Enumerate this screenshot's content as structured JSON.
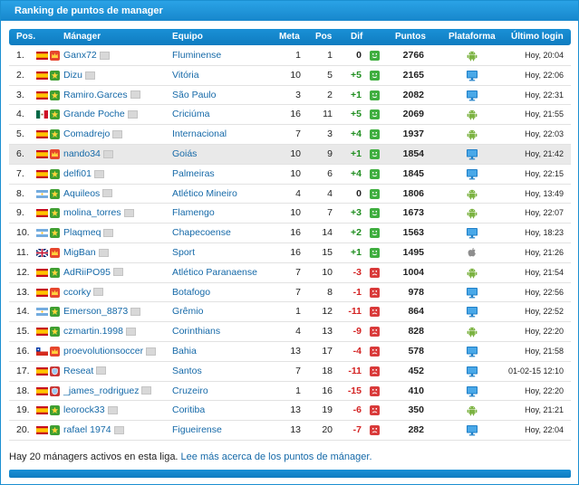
{
  "header": {
    "title": "Ranking de puntos de manager"
  },
  "columns": {
    "pos": "Pos.",
    "manager": "Mánager",
    "team": "Equipo",
    "meta": "Meta",
    "position": "Pos",
    "dif": "Dif",
    "points": "Puntos",
    "platform": "Plataforma",
    "last_login": "Último login"
  },
  "colors": {
    "accent": "#1787cc",
    "link": "#1569a8",
    "positive": "#1f8e1f",
    "negative": "#d42323",
    "face_green": "#3fae3f",
    "face_red": "#d93a3a"
  },
  "rows": [
    {
      "pos": "1.",
      "flag": "es",
      "badge": "crown",
      "name": "Ganx72",
      "team": "Fluminense",
      "meta": "1",
      "position": "1",
      "dif": "0",
      "face": "green",
      "points": "2766",
      "platform": "android",
      "login": "Hoy, 20:04"
    },
    {
      "pos": "2.",
      "flag": "es",
      "badge": "star",
      "name": "Dizu",
      "team": "Vitória",
      "meta": "10",
      "position": "5",
      "dif": "+5",
      "face": "green",
      "points": "2165",
      "platform": "pc",
      "login": "Hoy, 22:06"
    },
    {
      "pos": "3.",
      "flag": "es",
      "badge": "star",
      "name": "Ramiro.Garces",
      "team": "São Paulo",
      "meta": "3",
      "position": "2",
      "dif": "+1",
      "face": "green",
      "points": "2082",
      "platform": "pc",
      "login": "Hoy, 22:31"
    },
    {
      "pos": "4.",
      "flag": "mx",
      "badge": "star",
      "name": "Grande Poche",
      "team": "Criciúma",
      "meta": "16",
      "position": "11",
      "dif": "+5",
      "face": "green",
      "points": "2069",
      "platform": "android",
      "login": "Hoy, 21:55"
    },
    {
      "pos": "5.",
      "flag": "es",
      "badge": "star",
      "name": "Comadrejo",
      "team": "Internacional",
      "meta": "7",
      "position": "3",
      "dif": "+4",
      "face": "green",
      "points": "1937",
      "platform": "android",
      "login": "Hoy, 22:03"
    },
    {
      "pos": "6.",
      "flag": "es",
      "badge": "crown",
      "name": "nando34",
      "team": "Goiás",
      "meta": "10",
      "position": "9",
      "dif": "+1",
      "face": "green",
      "points": "1854",
      "platform": "pc",
      "login": "Hoy, 21:42",
      "highlight": true
    },
    {
      "pos": "7.",
      "flag": "es",
      "badge": "star",
      "name": "delfi01",
      "team": "Palmeiras",
      "meta": "10",
      "position": "6",
      "dif": "+4",
      "face": "green",
      "points": "1845",
      "platform": "pc",
      "login": "Hoy, 22:15"
    },
    {
      "pos": "8.",
      "flag": "ar",
      "badge": "star",
      "name": "Aquileos",
      "team": "Atlético Mineiro",
      "meta": "4",
      "position": "4",
      "dif": "0",
      "face": "green",
      "points": "1806",
      "platform": "android",
      "login": "Hoy, 13:49"
    },
    {
      "pos": "9.",
      "flag": "es",
      "badge": "star",
      "name": "molina_torres",
      "team": "Flamengo",
      "meta": "10",
      "position": "7",
      "dif": "+3",
      "face": "green",
      "points": "1673",
      "platform": "android",
      "login": "Hoy, 22:07"
    },
    {
      "pos": "10.",
      "flag": "ar",
      "badge": "star",
      "name": "Plaqmeq",
      "team": "Chapecoense",
      "meta": "16",
      "position": "14",
      "dif": "+2",
      "face": "green",
      "points": "1563",
      "platform": "pc",
      "login": "Hoy, 18:23"
    },
    {
      "pos": "11.",
      "flag": "gb",
      "badge": "crown",
      "name": "MigBan",
      "team": "Sport",
      "meta": "16",
      "position": "15",
      "dif": "+1",
      "face": "green",
      "points": "1495",
      "platform": "apple",
      "login": "Hoy, 21:26"
    },
    {
      "pos": "12.",
      "flag": "es",
      "badge": "star",
      "name": "AdRiiPO95",
      "team": "Atlético Paranaense",
      "meta": "7",
      "position": "10",
      "dif": "-3",
      "face": "red",
      "points": "1004",
      "platform": "android",
      "login": "Hoy, 21:54"
    },
    {
      "pos": "13.",
      "flag": "es",
      "badge": "crown",
      "name": "ccorky",
      "team": "Botafogo",
      "meta": "7",
      "position": "8",
      "dif": "-1",
      "face": "red",
      "points": "978",
      "platform": "pc",
      "login": "Hoy, 22:56"
    },
    {
      "pos": "14.",
      "flag": "ar",
      "badge": "star",
      "name": "Emerson_8873",
      "team": "Grêmio",
      "meta": "1",
      "position": "12",
      "dif": "-11",
      "face": "red",
      "points": "864",
      "platform": "pc",
      "login": "Hoy, 22:52"
    },
    {
      "pos": "15.",
      "flag": "es",
      "badge": "star",
      "name": "czmartin.1998",
      "team": "Corinthians",
      "meta": "4",
      "position": "13",
      "dif": "-9",
      "face": "red",
      "points": "828",
      "platform": "android",
      "login": "Hoy, 22:20"
    },
    {
      "pos": "16.",
      "flag": "cl",
      "badge": "crown",
      "name": "proevolutionsoccer",
      "team": "Bahia",
      "meta": "13",
      "position": "17",
      "dif": "-4",
      "face": "red",
      "points": "578",
      "platform": "pc",
      "login": "Hoy, 21:58"
    },
    {
      "pos": "17.",
      "flag": "es",
      "badge": "shield",
      "name": "Reseat",
      "team": "Santos",
      "meta": "7",
      "position": "18",
      "dif": "-11",
      "face": "red",
      "points": "452",
      "platform": "pc",
      "login": "01-02-15 12:10"
    },
    {
      "pos": "18.",
      "flag": "es",
      "badge": "shield",
      "name": "_james_rodriguez",
      "team": "Cruzeiro",
      "meta": "1",
      "position": "16",
      "dif": "-15",
      "face": "red",
      "points": "410",
      "platform": "pc",
      "login": "Hoy, 22:20"
    },
    {
      "pos": "19.",
      "flag": "es",
      "badge": "star",
      "name": "leorock33",
      "team": "Coritiba",
      "meta": "13",
      "position": "19",
      "dif": "-6",
      "face": "red",
      "points": "350",
      "platform": "android",
      "login": "Hoy, 21:21"
    },
    {
      "pos": "20.",
      "flag": "es",
      "badge": "star",
      "name": "rafael 1974",
      "team": "Figueirense",
      "meta": "13",
      "position": "20",
      "dif": "-7",
      "face": "red",
      "points": "282",
      "platform": "pc",
      "login": "Hoy, 22:04"
    }
  ],
  "footer": {
    "text": "Hay 20 mánagers activos en esta liga. ",
    "link": "Lee más acerca de los puntos de mánager."
  }
}
